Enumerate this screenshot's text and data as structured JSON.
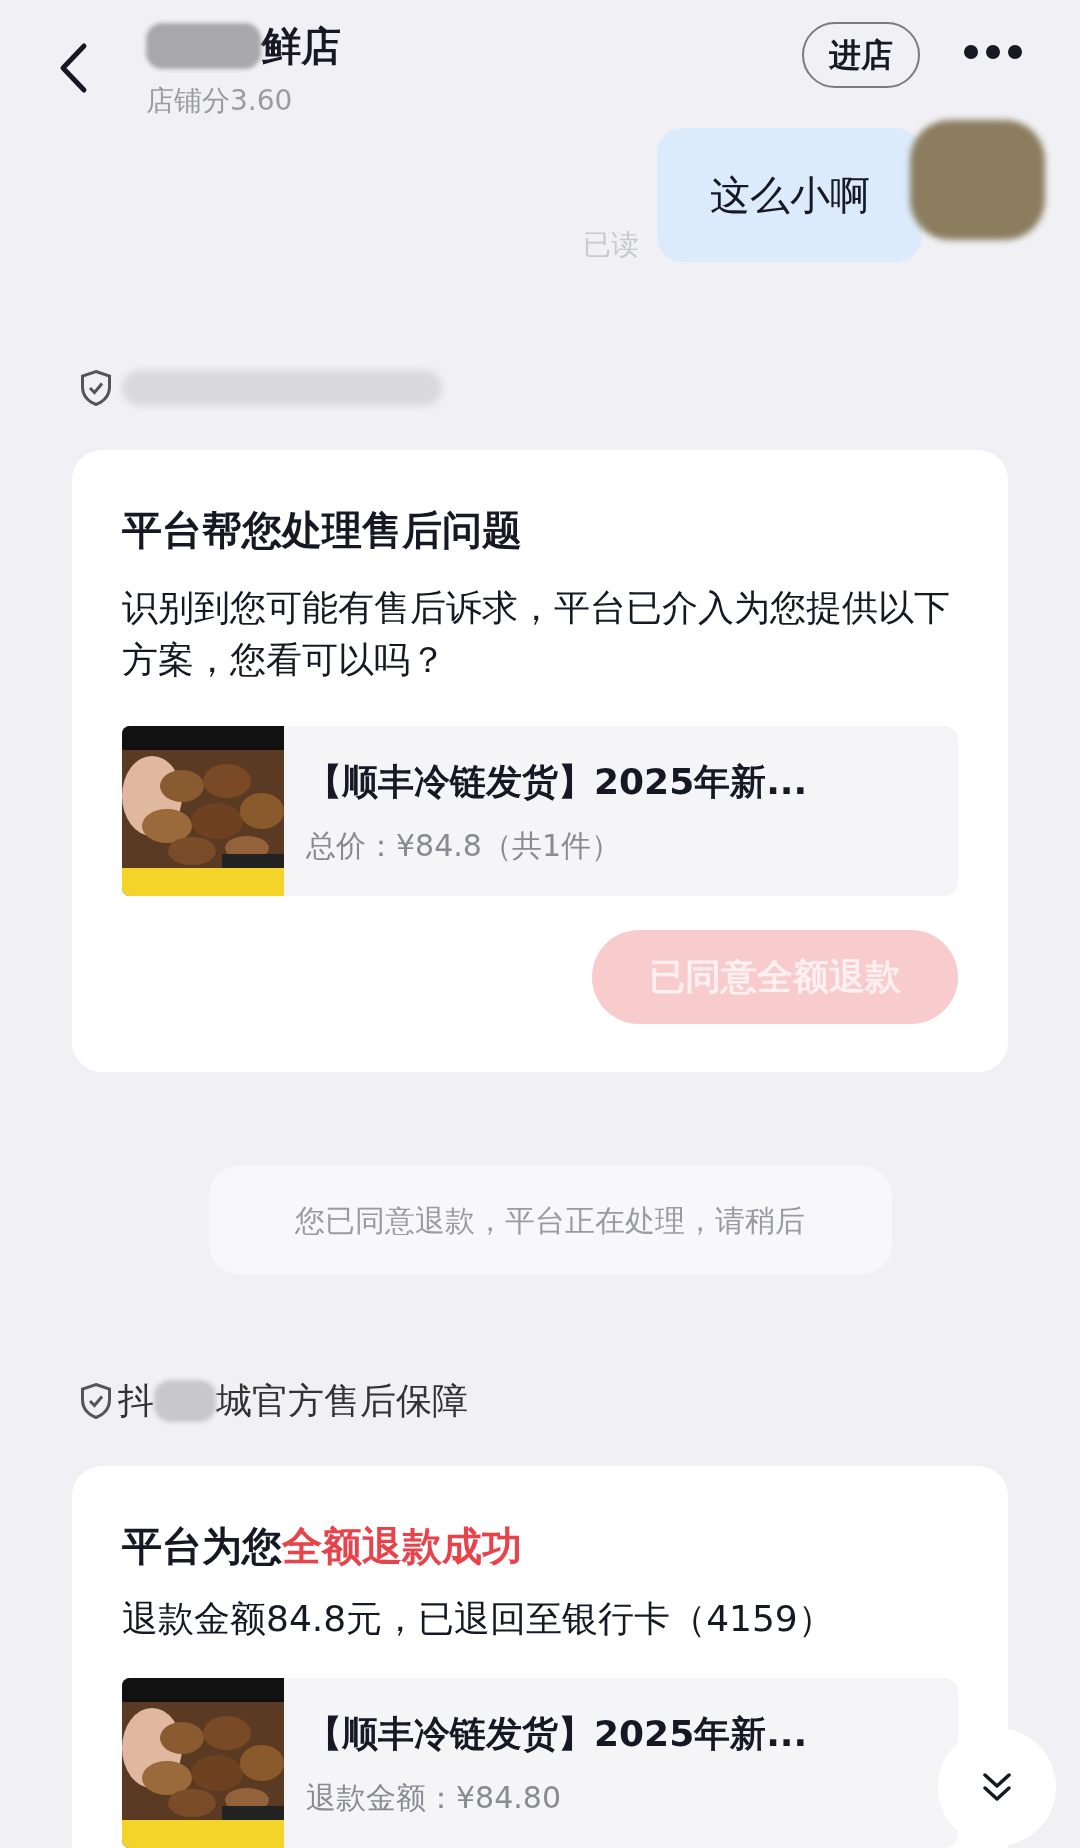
{
  "header": {
    "title": "鲜店",
    "subtitle": "店铺分3.60",
    "store_button": "进店"
  },
  "message": {
    "text": "这么小啊",
    "receipt": "已读"
  },
  "card1": {
    "title": "平台帮您处理售后问题",
    "description": "识别到您可能有售后诉求，平台已介入为您提供以下方案，您看可以吗？",
    "product": {
      "kind": "picture",
      "title": "【顺丰冷链发货】2025年新...",
      "detail": "总价：¥84.8（共1件）"
    },
    "action": {
      "label": "已同意全额退款",
      "disabled": true
    }
  },
  "system_notice": "您已同意退款，平台正在处理，请稍后",
  "guarantee": {
    "prefix": "抖",
    "suffix": "城官方售后保障"
  },
  "card2": {
    "title_prefix": "平台为您",
    "title_highlight": "全额退款成功",
    "description": "退款金额84.8元，已退回至银行卡（4159）",
    "product": {
      "kind": "picture",
      "title": "【顺丰冷链发货】2025年新...",
      "detail": "退款金额：¥84.80"
    }
  }
}
